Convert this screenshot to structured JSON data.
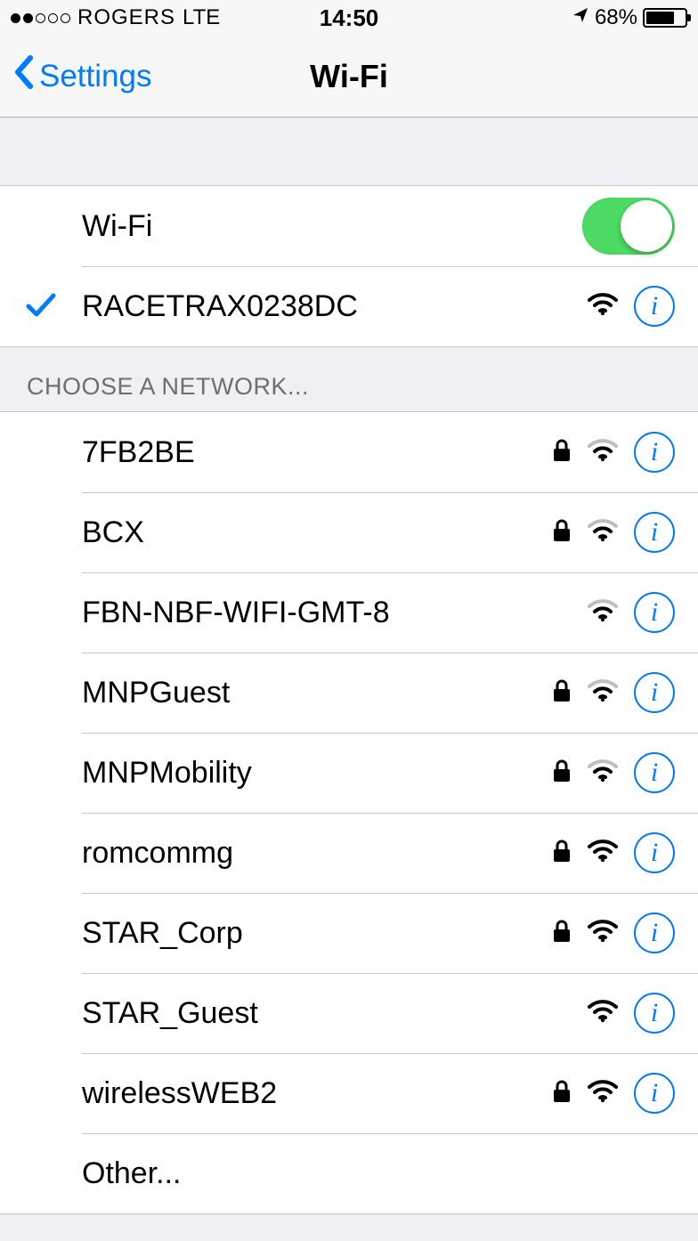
{
  "status_bar": {
    "signal_dots_filled": 2,
    "carrier": "ROGERS",
    "network": "LTE",
    "time": "14:50",
    "battery_pct": "68%",
    "battery_fill_pct": 68
  },
  "nav": {
    "back_label": "Settings",
    "title": "Wi-Fi"
  },
  "wifi_toggle": {
    "label": "Wi-Fi",
    "on": true
  },
  "connected_network": {
    "name": "RACETRAX0238DC",
    "locked": false,
    "signal": 3
  },
  "choose_header": "CHOOSE A NETWORK...",
  "networks": [
    {
      "name": "7FB2BE",
      "locked": true,
      "signal": 2
    },
    {
      "name": "BCX",
      "locked": true,
      "signal": 2
    },
    {
      "name": "FBN-NBF-WIFI-GMT-8",
      "locked": false,
      "signal": 2
    },
    {
      "name": "MNPGuest",
      "locked": true,
      "signal": 2
    },
    {
      "name": "MNPMobility",
      "locked": true,
      "signal": 2
    },
    {
      "name": "romcommg",
      "locked": true,
      "signal": 3
    },
    {
      "name": "STAR_Corp",
      "locked": true,
      "signal": 3
    },
    {
      "name": "STAR_Guest",
      "locked": false,
      "signal": 3
    },
    {
      "name": "wirelessWEB2",
      "locked": true,
      "signal": 3
    }
  ],
  "other_label": "Other..."
}
